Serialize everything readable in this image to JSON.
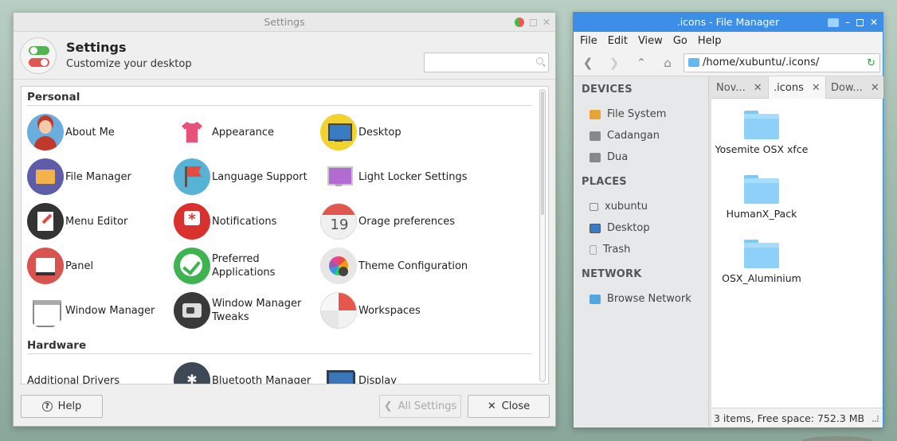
{
  "settings": {
    "window_title": "Settings",
    "header_title": "Settings",
    "header_subtitle": "Customize your desktop",
    "search_placeholder": "",
    "sections": {
      "personal": "Personal",
      "hardware": "Hardware"
    },
    "personal_items": [
      {
        "label": "About Me",
        "icon": "about-me-icon"
      },
      {
        "label": "Appearance",
        "icon": "appearance-icon"
      },
      {
        "label": "Desktop",
        "icon": "desktop-icon"
      },
      {
        "label": "File Manager",
        "icon": "file-manager-icon"
      },
      {
        "label": "Language Support",
        "icon": "language-support-icon"
      },
      {
        "label": "Light Locker Settings",
        "icon": "light-locker-icon"
      },
      {
        "label": "Menu Editor",
        "icon": "menu-editor-icon"
      },
      {
        "label": "Notifications",
        "icon": "notifications-icon"
      },
      {
        "label": "Orage preferences",
        "icon": "orage-calendar-icon"
      },
      {
        "label": "Panel",
        "icon": "panel-icon"
      },
      {
        "label_line1": "Preferred",
        "label_line2": "Applications",
        "icon": "preferred-applications-icon"
      },
      {
        "label": "Theme Configuration",
        "icon": "theme-configuration-icon"
      },
      {
        "label": "Window Manager",
        "icon": "window-manager-icon"
      },
      {
        "label_line1": "Window Manager",
        "label_line2": "Tweaks",
        "icon": "window-manager-tweaks-icon"
      },
      {
        "label": "Workspaces",
        "icon": "workspaces-icon"
      }
    ],
    "hardware_items": [
      {
        "label": "Additional Drivers"
      },
      {
        "label": "Bluetooth Manager",
        "icon": "bluetooth-icon"
      },
      {
        "label": "Display",
        "icon": "display-icon"
      }
    ],
    "buttons": {
      "help": "Help",
      "all_settings": "All Settings",
      "close": "Close"
    }
  },
  "file_manager": {
    "window_title": ".icons - File Manager",
    "menu": [
      "File",
      "Edit",
      "View",
      "Go",
      "Help"
    ],
    "path": "/home/xubuntu/.icons/",
    "sidebar": {
      "devices_title": "DEVICES",
      "devices": [
        "File System",
        "Cadangan",
        "Dua"
      ],
      "places_title": "PLACES",
      "places": [
        "xubuntu",
        "Desktop",
        "Trash"
      ],
      "network_title": "NETWORK",
      "network": [
        "Browse Network"
      ]
    },
    "tabs": [
      "Nov...",
      ".icons",
      "Dow..."
    ],
    "active_tab_index": 1,
    "folders": [
      "Yosemite OSX xfce",
      "HumanX_Pack",
      "OSX_Aluminium"
    ],
    "status": "3 items, Free space: 752.3 MB"
  }
}
